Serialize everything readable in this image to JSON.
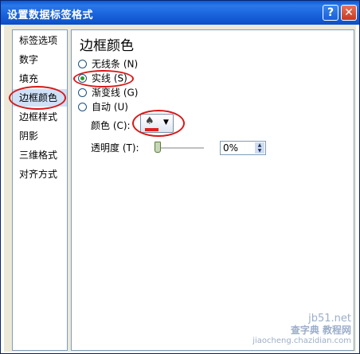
{
  "window": {
    "title": "设置数据标签格式",
    "help_label": "?",
    "close_label": "✕"
  },
  "sidebar": {
    "items": [
      {
        "label": "标签选项"
      },
      {
        "label": "数字"
      },
      {
        "label": "填充"
      },
      {
        "label": "边框颜色",
        "selected": true
      },
      {
        "label": "边框样式"
      },
      {
        "label": "阴影"
      },
      {
        "label": "三维格式"
      },
      {
        "label": "对齐方式"
      }
    ]
  },
  "panel": {
    "section_title": "边框颜色",
    "options": [
      {
        "label": "无线条 (N)",
        "checked": false
      },
      {
        "label": "实线 (S)",
        "checked": true
      },
      {
        "label": "渐变线 (G)",
        "checked": false
      },
      {
        "label": "自动 (U)",
        "checked": false
      }
    ],
    "color_label": "颜色 (C):",
    "color_value": "#e02020",
    "transparency_label": "透明度 (T):",
    "transparency_value": "0%",
    "transparency_fraction": 0
  },
  "watermark": {
    "site": "jb51.net",
    "brand": "查字典 教程网",
    "url": "jiaocheng.chazidian.com"
  },
  "colors": {
    "titlebar": "#1a64dc",
    "selection": "#cfe0f7",
    "annotation": "#d81818"
  }
}
